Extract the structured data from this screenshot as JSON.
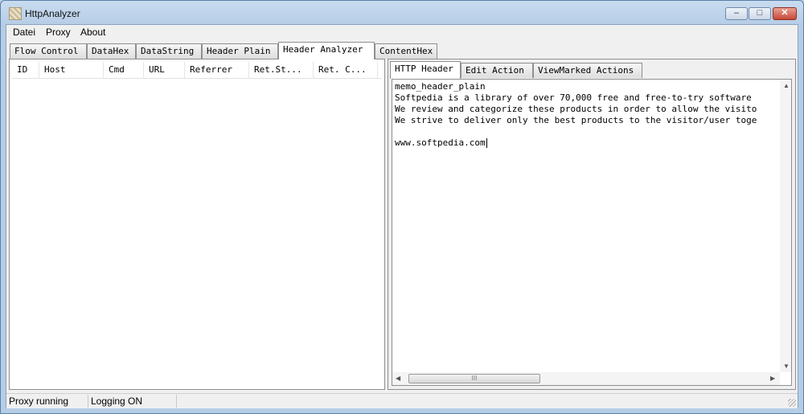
{
  "window": {
    "title": "HttpAnalyzer",
    "minimize_glyph": "–",
    "maximize_glyph": "□",
    "close_glyph": "✕"
  },
  "menu": {
    "items": [
      "Datei",
      "Proxy",
      "About"
    ]
  },
  "main_tabs": {
    "items": [
      "Flow Control",
      "DataHex",
      "DataString",
      "Header Plain",
      "Header Analyzer",
      "ContentHex"
    ],
    "active": "Header Analyzer"
  },
  "request_list": {
    "columns": [
      "ID",
      "Host",
      "Cmd",
      "URL",
      "Referrer",
      "Ret.St...",
      "Ret. C..."
    ],
    "rows": []
  },
  "detail_tabs": {
    "items": [
      "HTTP Header",
      "Edit Action",
      "ViewMarked Actions"
    ],
    "active": "HTTP Header"
  },
  "memo": {
    "lines": [
      "memo_header_plain",
      "Softpedia is a library of over 70,000 free and free-to-try software",
      "We review and categorize these products in order to allow the visito",
      "We strive to deliver only the best products to the visitor/user toge",
      "",
      "www.softpedia.com"
    ]
  },
  "scrollbar": {
    "thumb_grip": "III",
    "up_arrow": "▲",
    "down_arrow": "▼",
    "left_arrow": "◀",
    "right_arrow": "▶"
  },
  "status": {
    "proxy": "Proxy running",
    "logging": "Logging ON"
  }
}
